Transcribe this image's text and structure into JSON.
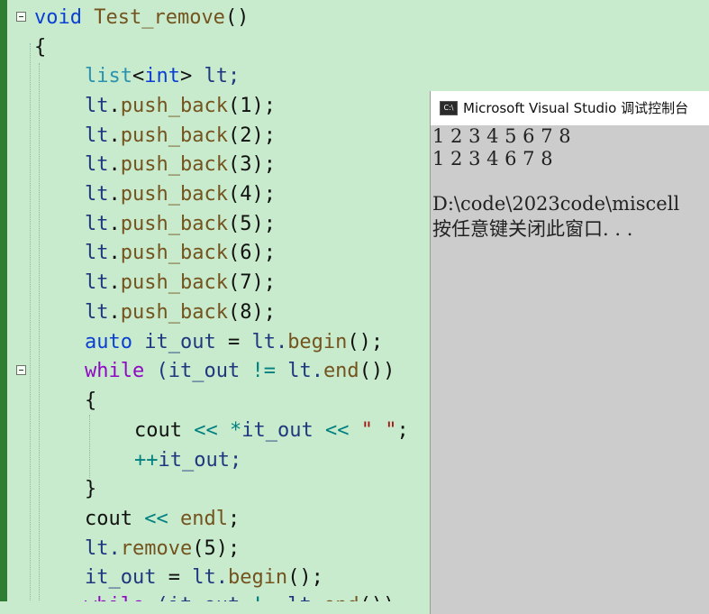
{
  "console": {
    "icon_text": "C:\\",
    "title": "Microsoft Visual Studio 调试控制台",
    "output": [
      "1 2 3 4 5 6 7 8",
      "1 2 3 4 6 7 8",
      "",
      "D:\\code\\2023code\\miscell",
      "按任意键关闭此窗口. . ."
    ]
  },
  "code": {
    "l1": {
      "kw": "void",
      "fn": "Test_remove",
      "p": "()"
    },
    "l2": "{",
    "l3": {
      "t1": "list",
      "p1": "<",
      "t2": "int",
      "p2": ">",
      "id": " lt;"
    },
    "push_lines": [
      {
        "obj": "lt",
        "dot": ".",
        "fn": "push_back",
        "args": "(1);"
      },
      {
        "obj": "lt",
        "dot": ".",
        "fn": "push_back",
        "args": "(2);"
      },
      {
        "obj": "lt",
        "dot": ".",
        "fn": "push_back",
        "args": "(3);"
      },
      {
        "obj": "lt",
        "dot": ".",
        "fn": "push_back",
        "args": "(4);"
      },
      {
        "obj": "lt",
        "dot": ".",
        "fn": "push_back",
        "args": "(5);"
      },
      {
        "obj": "lt",
        "dot": ".",
        "fn": "push_back",
        "args": "(6);"
      },
      {
        "obj": "lt",
        "dot": ".",
        "fn": "push_back",
        "args": "(7);"
      },
      {
        "obj": "lt",
        "dot": ".",
        "fn": "push_back",
        "args": "(8);"
      }
    ],
    "l12": {
      "kw": "auto",
      "a": " it_out ",
      "op": "=",
      "b": " lt.",
      "fn": "begin",
      "c": "();"
    },
    "l13": {
      "kw": "while",
      "a": " (it_out ",
      "op": "!=",
      "b": " lt.",
      "fn": "end",
      "c": "())"
    },
    "l14": "{",
    "l15": {
      "a": "cout ",
      "op1": "<<",
      "op2": " *",
      "b": "it_out ",
      "op3": "<<",
      "s": " \" \"",
      "c": ";"
    },
    "l16": {
      "op": "++",
      "a": "it_out;"
    },
    "l17": "}",
    "l18": {
      "a": "cout ",
      "op": "<<",
      "b": " endl",
      "c": ";"
    },
    "l19": {
      "a": "lt.",
      "fn": "remove",
      "c": "(5);"
    },
    "l20": {
      "a": "it_out ",
      "op": "=",
      "b": " lt.",
      "fn": "begin",
      "c": "();"
    },
    "l21": {
      "kw": "while",
      "a": " (it_out ",
      "op": "!=",
      "b": " lt.",
      "fn": "end",
      "c": "())"
    }
  }
}
